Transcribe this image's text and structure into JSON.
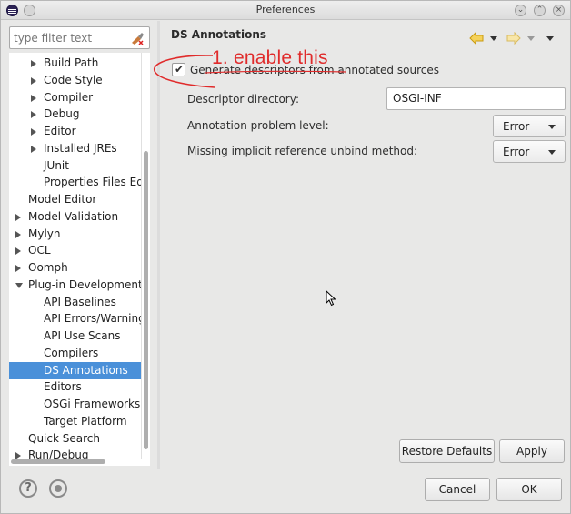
{
  "window": {
    "title": "Preferences"
  },
  "filter": {
    "placeholder": "type filter text"
  },
  "tree": {
    "items": [
      {
        "label": "Build Path",
        "indent": 2,
        "arrow": "collapsed",
        "selected": false
      },
      {
        "label": "Code Style",
        "indent": 2,
        "arrow": "collapsed",
        "selected": false
      },
      {
        "label": "Compiler",
        "indent": 2,
        "arrow": "collapsed",
        "selected": false
      },
      {
        "label": "Debug",
        "indent": 2,
        "arrow": "collapsed",
        "selected": false
      },
      {
        "label": "Editor",
        "indent": 2,
        "arrow": "collapsed",
        "selected": false
      },
      {
        "label": "Installed JREs",
        "indent": 2,
        "arrow": "collapsed",
        "selected": false
      },
      {
        "label": "JUnit",
        "indent": 2,
        "arrow": "none",
        "selected": false
      },
      {
        "label": "Properties Files Editor",
        "indent": 2,
        "arrow": "none",
        "selected": false
      },
      {
        "label": "Model Editor",
        "indent": 1,
        "arrow": "none",
        "selected": false
      },
      {
        "label": "Model Validation",
        "indent": 1,
        "arrow": "collapsed",
        "selected": false
      },
      {
        "label": "Mylyn",
        "indent": 1,
        "arrow": "collapsed",
        "selected": false
      },
      {
        "label": "OCL",
        "indent": 1,
        "arrow": "collapsed",
        "selected": false
      },
      {
        "label": "Oomph",
        "indent": 1,
        "arrow": "collapsed",
        "selected": false
      },
      {
        "label": "Plug-in Development",
        "indent": 1,
        "arrow": "expanded",
        "selected": false
      },
      {
        "label": "API Baselines",
        "indent": 2,
        "arrow": "none",
        "selected": false
      },
      {
        "label": "API Errors/Warnings",
        "indent": 2,
        "arrow": "none",
        "selected": false
      },
      {
        "label": "API Use Scans",
        "indent": 2,
        "arrow": "none",
        "selected": false
      },
      {
        "label": "Compilers",
        "indent": 2,
        "arrow": "none",
        "selected": false
      },
      {
        "label": "DS Annotations",
        "indent": 2,
        "arrow": "none",
        "selected": true
      },
      {
        "label": "Editors",
        "indent": 2,
        "arrow": "none",
        "selected": false
      },
      {
        "label": "OSGi Frameworks",
        "indent": 2,
        "arrow": "none",
        "selected": false
      },
      {
        "label": "Target Platform",
        "indent": 2,
        "arrow": "none",
        "selected": false
      },
      {
        "label": "Quick Search",
        "indent": 1,
        "arrow": "none",
        "selected": false
      },
      {
        "label": "Run/Debug",
        "indent": 1,
        "arrow": "collapsed",
        "selected": false
      }
    ]
  },
  "page": {
    "title": "DS Annotations",
    "generate_checkbox": {
      "label": "Generate descriptors from annotated sources",
      "checked": true
    },
    "descriptor_directory": {
      "label": "Descriptor directory:",
      "value": "OSGI-INF"
    },
    "annotation_problem_level": {
      "label": "Annotation problem level:",
      "value": "Error"
    },
    "missing_unbind": {
      "label": "Missing implicit reference unbind method:",
      "value": "Error"
    },
    "restore_defaults_label": "Restore Defaults",
    "apply_label": "Apply"
  },
  "footer": {
    "cancel_label": "Cancel",
    "ok_label": "OK"
  },
  "annotation": {
    "text": "1. enable this",
    "color": "#e02b2b"
  },
  "colors": {
    "selection": "#4a90d9",
    "nav_arrow": "#f0b020"
  }
}
